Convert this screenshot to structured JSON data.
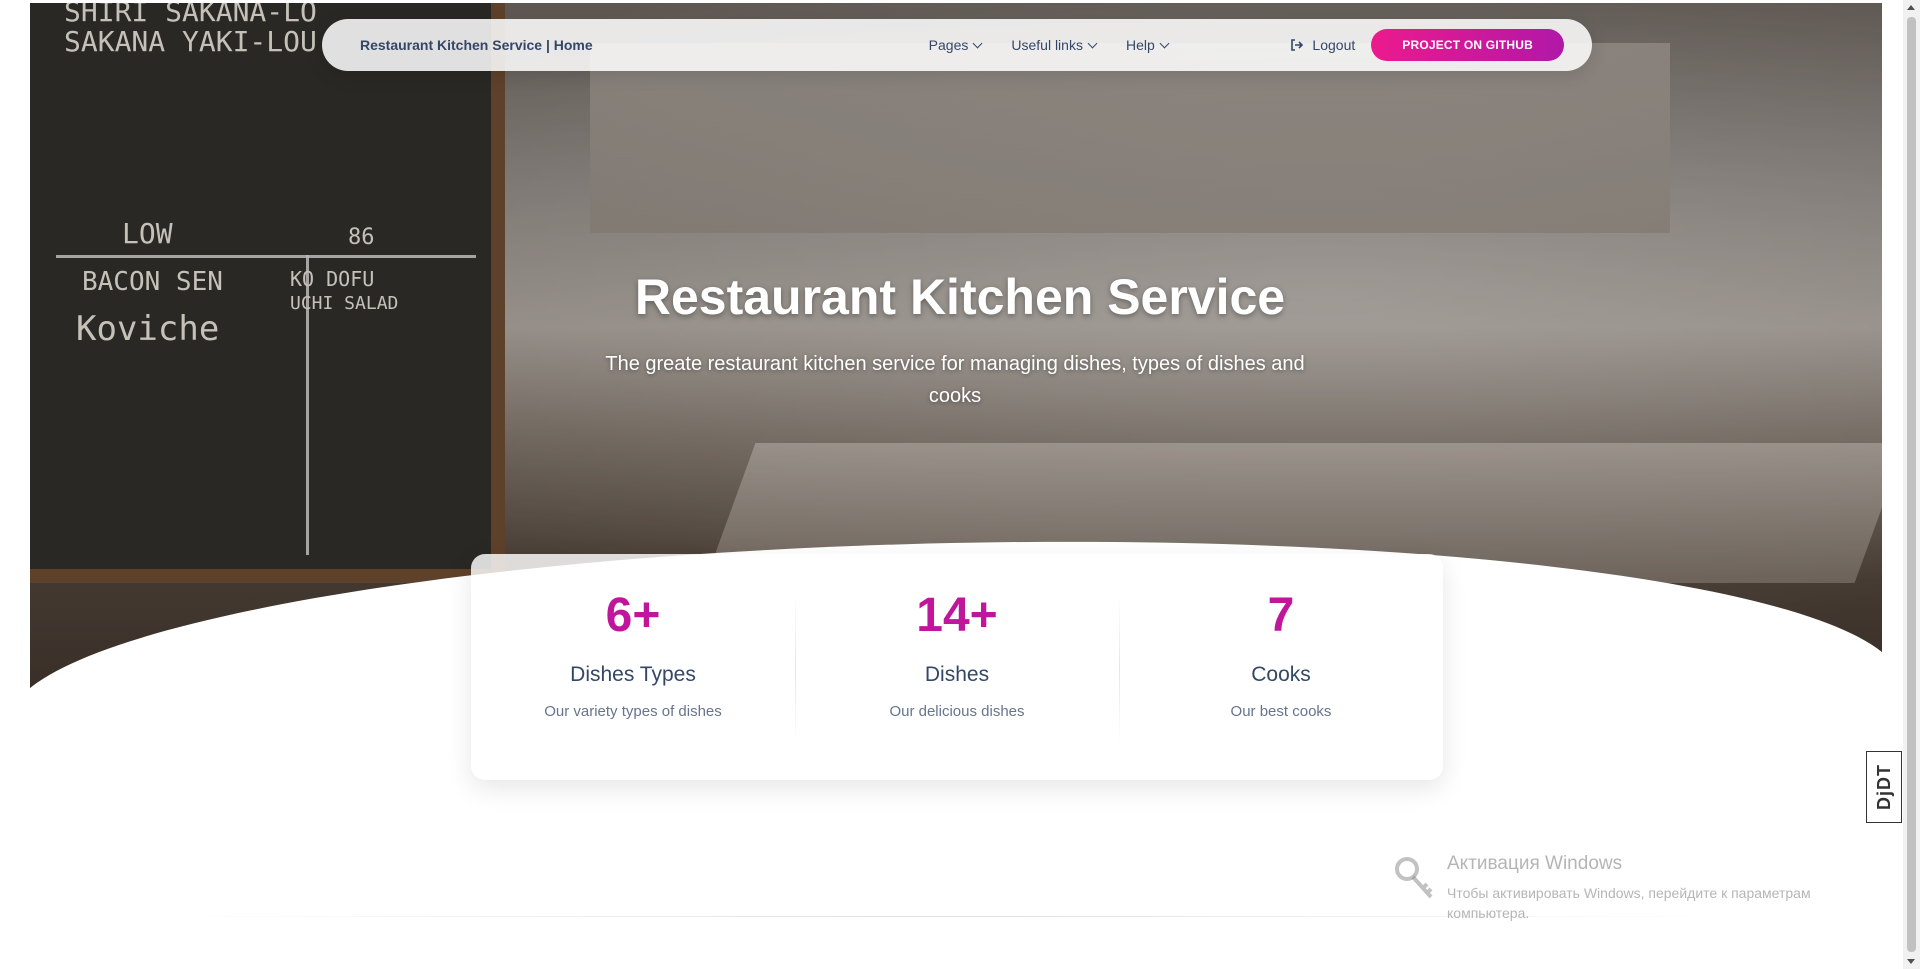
{
  "navbar": {
    "brand": "Restaurant Kitchen Service | Home",
    "menu": [
      {
        "label": "Pages"
      },
      {
        "label": "Useful links"
      },
      {
        "label": "Help"
      }
    ],
    "logout_label": "Logout",
    "github_label": "PROJECT ON GITHUB"
  },
  "hero": {
    "title": "Restaurant Kitchen Service",
    "subtitle": "The greate restaurant kitchen service for managing dishes, types of dishes and cooks",
    "chalkboard": {
      "line1": "SHIRI SAKANA-LO",
      "line2": "SAKANA YAKI-LOU",
      "low": "LOW",
      "num": "86",
      "item1": "BACON SEN",
      "item2": "Koviche",
      "item3": "KO DOFU",
      "item4": "UCHI SALAD"
    }
  },
  "stats": [
    {
      "number": "6+",
      "title": "Dishes Types",
      "desc": "Our variety types of dishes"
    },
    {
      "number": "14+",
      "title": "Dishes",
      "desc": "Our delicious dishes"
    },
    {
      "number": "7",
      "title": "Cooks",
      "desc": "Our best cooks"
    }
  ],
  "watermark": {
    "title": "Активация Windows",
    "subtitle": "Чтобы активировать Windows, перейдите к параметрам компьютера."
  },
  "djdt": {
    "label": "DjDT"
  },
  "colors": {
    "accent": "#c0169c",
    "button_from": "#ec1a8c",
    "button_to": "#b118a8",
    "text_dark": "#344767",
    "text_muted": "#67748e"
  }
}
